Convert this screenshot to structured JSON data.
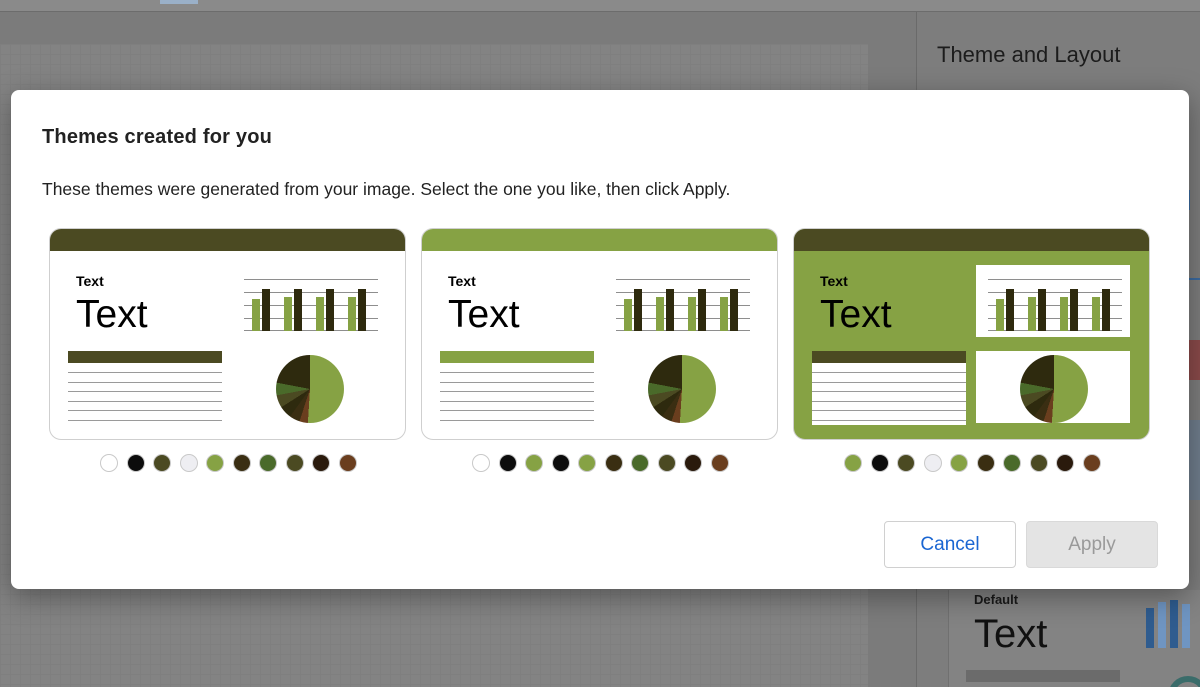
{
  "background": {
    "panel_title": "Theme and Layout",
    "default_theme": {
      "label": "Default",
      "sample": "Text"
    }
  },
  "dialog": {
    "title": "Themes created for you",
    "description": "These themes were generated from your image. Select the one you like, then click Apply.",
    "cancel_label": "Cancel",
    "apply_label": "Apply",
    "apply_enabled": false
  },
  "themes": [
    {
      "small_text": "Text",
      "big_text": "Text",
      "header_color": "#4b4a22",
      "background_color": "#ffffff",
      "table_head_color": "#4b4a22",
      "bar_series": [
        "#86a244",
        "#2e2a0e"
      ],
      "swatches": [
        "#ffffff",
        "#0c0c0c",
        "#4b4a22",
        "#eeeef2",
        "#86a244",
        "#3a2e12",
        "#4a6a2a",
        "#4b4a22",
        "#2a1a0c",
        "#6a3e1e"
      ]
    },
    {
      "small_text": "Text",
      "big_text": "Text",
      "header_color": "#86a244",
      "background_color": "#ffffff",
      "table_head_color": "#86a244",
      "bar_series": [
        "#86a244",
        "#2e2a0e"
      ],
      "swatches": [
        "#ffffff",
        "#0c0c0c",
        "#86a244",
        "#0c0c0c",
        "#86a244",
        "#3a2e12",
        "#4a6a2a",
        "#4b4a22",
        "#2a1a0c",
        "#6a3e1e"
      ]
    },
    {
      "small_text": "Text",
      "big_text": "Text",
      "header_color": "#4b4a22",
      "background_color": "#86a244",
      "table_head_color": "#4b4a22",
      "bar_series": [
        "#86a244",
        "#2e2a0e"
      ],
      "swatches": [
        "#86a244",
        "#0c0c0c",
        "#4b4a22",
        "#eeeef2",
        "#86a244",
        "#3a2e12",
        "#4a6a2a",
        "#4b4a22",
        "#2a1a0c",
        "#6a3e1e"
      ]
    }
  ]
}
